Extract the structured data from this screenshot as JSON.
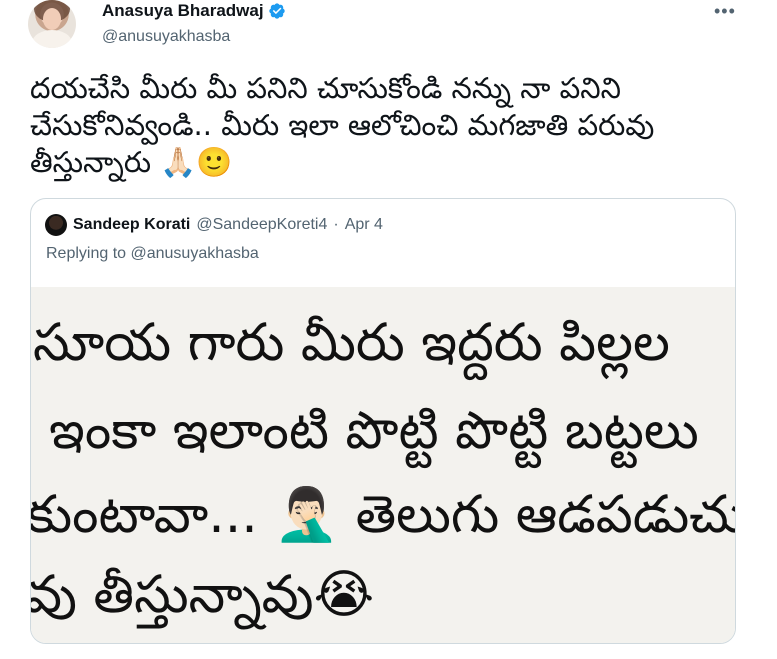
{
  "tweet": {
    "display_name": "Anasuya Bharadwaj",
    "handle": "@anusuyakhasba",
    "more_icon": "more-horizontal-icon",
    "lines": [
      "దయచేసి మీరు మీ పనిని చూసుకోండి నన్ను నా పనిని",
      "చేసుకోనివ్వండి.. మీరు ఇలా ఆలోచించి మగజాతి పరువు",
      "తీస్తున్నారు 🙏🏻🙂"
    ]
  },
  "quote": {
    "name": "Sandeep Korati",
    "handle": "@SandeepKoreti4",
    "separator": "·",
    "date": "Apr 4",
    "replying_to": "Replying to @anusuyakhasba",
    "image_lines": [
      "సూయ గారు మీరు ఇద్దరు పిల్లల",
      "ఇంకా ఇలాంటి పొట్టి పొట్టి బట్టలు",
      "కుంటావా... 🤦🏻‍♂️ తెలుగు ఆడపడుచు",
      "వు తీస్తున్నావు😭"
    ]
  },
  "colors": {
    "text": "#0f1419",
    "secondary": "#536471",
    "border": "#cfd9de",
    "verified": "#1d9bf0"
  }
}
